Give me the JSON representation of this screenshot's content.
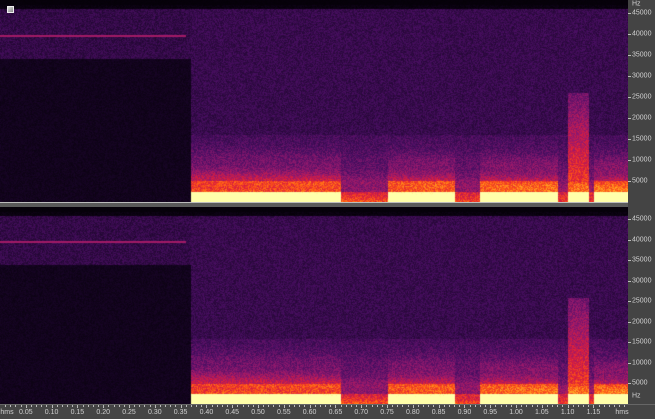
{
  "frequency_axis": {
    "unit": "Hz",
    "labels": [
      "45000",
      "40000",
      "35000",
      "30000",
      "25000",
      "20000",
      "15000",
      "10000",
      "5000"
    ],
    "values": [
      45000,
      40000,
      35000,
      30000,
      25000,
      20000,
      15000,
      10000,
      5000
    ],
    "max": 48000
  },
  "time_axis": {
    "unit_left": "hms",
    "unit_right": "hms",
    "labels": [
      "0.05",
      "0.10",
      "0.15",
      "0.20",
      "0.25",
      "0.30",
      "0.35",
      "0.40",
      "0.45",
      "0.50",
      "0.55",
      "0.60",
      "0.65",
      "0.70",
      "0.75",
      "0.80",
      "0.85",
      "0.90",
      "0.95",
      "1.00",
      "1.05",
      "1.10",
      "1.15"
    ],
    "values": [
      0.05,
      0.1,
      0.15,
      0.2,
      0.25,
      0.3,
      0.35,
      0.4,
      0.45,
      0.5,
      0.55,
      0.6,
      0.65,
      0.7,
      0.75,
      0.8,
      0.85,
      0.9,
      0.95,
      1.0,
      1.05,
      1.1,
      1.15
    ],
    "duration": 1.217
  },
  "spectrogram": {
    "channels": [
      "channel-1",
      "channel-2"
    ],
    "tone": {
      "freq_hz": 39500,
      "start": 0.0,
      "end": 0.36
    },
    "speech_start": 0.37,
    "loud_segments": [
      [
        0.37,
        0.66
      ],
      [
        0.75,
        0.88
      ],
      [
        0.93,
        1.08
      ],
      [
        1.1,
        1.14
      ],
      [
        1.15,
        1.217
      ]
    ],
    "burst": {
      "start": 1.1,
      "end": 1.14,
      "max_hz": 26000
    }
  }
}
